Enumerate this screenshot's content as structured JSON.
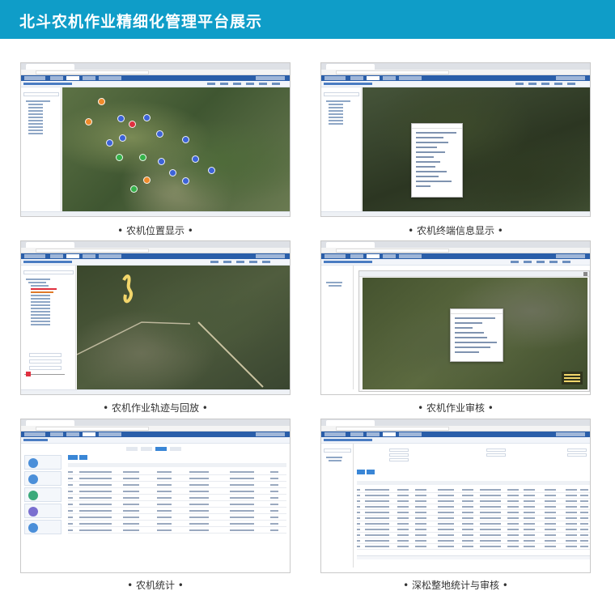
{
  "banner": {
    "title": "北斗农机作业精细化管理平台展示",
    "color": "#0f9dc8"
  },
  "screenshots": [
    {
      "caption": "• 农机位置显示 •"
    },
    {
      "caption": "• 农机终端信息显示 •"
    },
    {
      "caption": "• 农机作业轨迹与回放 •"
    },
    {
      "caption": "• 农机作业审核 •"
    },
    {
      "caption": "• 农机统计 •"
    },
    {
      "caption": "• 深松整地统计与审核 •"
    }
  ],
  "colors": {
    "app_nav": "#2a5ea9",
    "marker_orange": "#f08a2a",
    "marker_blue": "#3d63d8",
    "marker_green": "#35b24a",
    "marker_red": "#e0303f",
    "track_yellow": "#f2d66b",
    "button_blue": "#3a86d6"
  }
}
